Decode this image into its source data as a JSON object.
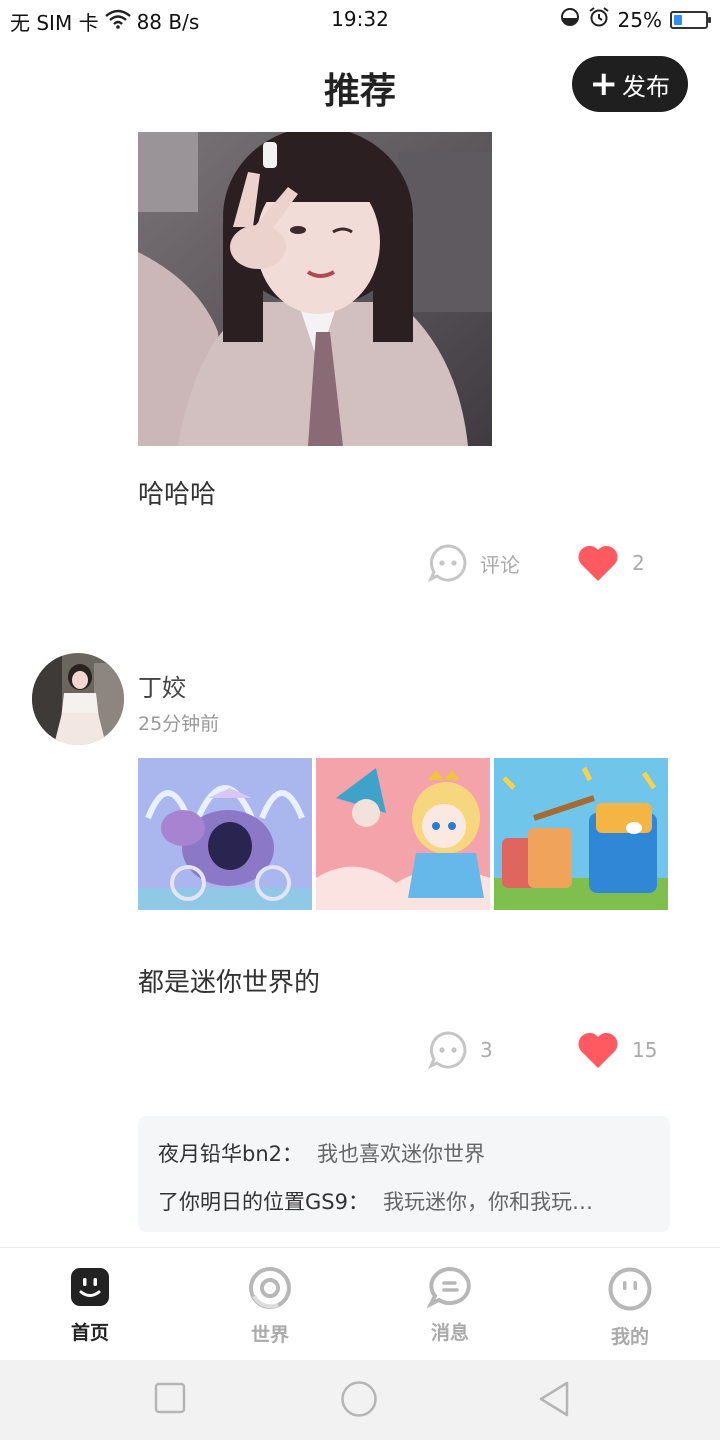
{
  "status_bar": {
    "carrier": "无 SIM 卡",
    "net_speed": "88 B/s",
    "time": "19:32",
    "battery_text": "25%",
    "battery_level": 0.25
  },
  "header": {
    "title": "推荐",
    "publish_label": "发布"
  },
  "post1": {
    "text": "哈哈哈",
    "comment_label": "评论",
    "like_count": "2"
  },
  "post2": {
    "username": "丁姣",
    "time": "25分钟前",
    "text": "都是迷你世界的",
    "comment_count": "3",
    "like_count": "15",
    "comments": [
      {
        "user": "夜月铅华bn2：",
        "text": "我也喜欢迷你世界"
      },
      {
        "user": "了你明日的位置GS9：",
        "text": "我玩迷你，你和我玩…"
      }
    ]
  },
  "tabbar": {
    "tabs": [
      {
        "label": "首页",
        "icon": "smile-square-icon",
        "active": true
      },
      {
        "label": "世界",
        "icon": "ring-icon",
        "active": false
      },
      {
        "label": "消息",
        "icon": "chat-bubble-icon",
        "active": false
      },
      {
        "label": "我的",
        "icon": "face-circle-icon",
        "active": false
      }
    ]
  },
  "colors": {
    "heart": "#ff5a5f",
    "publish_bg": "#1f1f1f",
    "comment_bg": "#f5f6f8"
  }
}
